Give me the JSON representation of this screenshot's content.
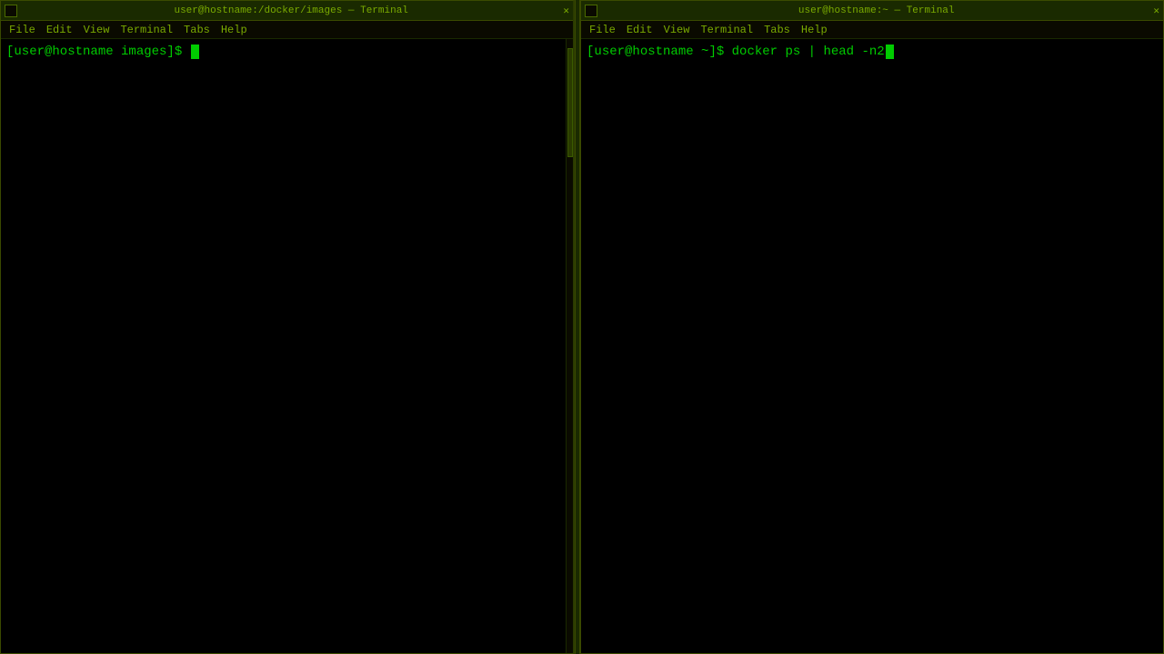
{
  "left_terminal": {
    "title": "user@hostname:/docker/images — Terminal",
    "menu": {
      "file": "File",
      "edit": "Edit",
      "view": "View",
      "terminal": "Terminal",
      "tabs": "Tabs",
      "help": "Help"
    },
    "prompt": "[user@hostname images]$ ",
    "cursor": true
  },
  "right_terminal": {
    "title": "user@hostname:~ — Terminal",
    "menu": {
      "file": "File",
      "edit": "Edit",
      "view": "View",
      "terminal": "Terminal",
      "tabs": "Tabs",
      "help": "Help"
    },
    "prompt": "[user@hostname ~]$ ",
    "command": "docker ps | head -n2",
    "cursor": true
  },
  "colors": {
    "terminal_green": "#00cc00",
    "title_green": "#7aaa00",
    "background": "#000000",
    "titlebar_bg": "#1a2a00",
    "border": "#3a4a00"
  }
}
